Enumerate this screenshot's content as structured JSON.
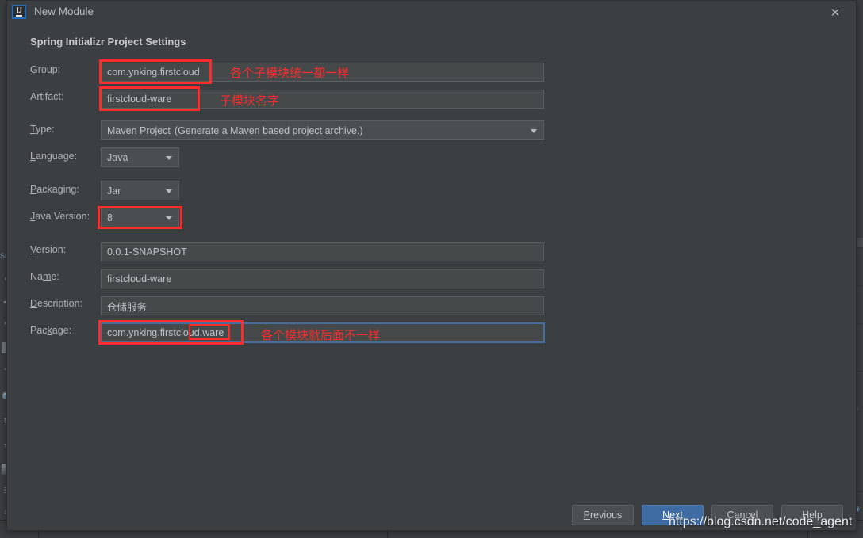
{
  "window": {
    "title": "New Module",
    "app_icon": "intellij-idea-logo",
    "close_icon": "close-icon"
  },
  "section": {
    "heading": "Spring Initializr Project Settings"
  },
  "form": {
    "group": {
      "label": "Group:",
      "mnemonic": "G",
      "value": "com.ynking.firstcloud"
    },
    "artifact": {
      "label": "Artifact:",
      "mnemonic": "A",
      "value": "firstcloud-ware"
    },
    "type": {
      "label": "Type:",
      "mnemonic": "T",
      "value": "Maven Project",
      "hint": "(Generate a Maven based project archive.)"
    },
    "language": {
      "label": "Language:",
      "mnemonic": "L",
      "value": "Java"
    },
    "packaging": {
      "label": "Packaging:",
      "mnemonic": "P",
      "value": "Jar"
    },
    "java_version": {
      "label": "Java Version:",
      "mnemonic": "J",
      "value": "8"
    },
    "version": {
      "label": "Version:",
      "mnemonic": "V",
      "value": "0.0.1-SNAPSHOT"
    },
    "name": {
      "label": "Name:",
      "mnemonic": "m",
      "value": "firstcloud-ware"
    },
    "description": {
      "label": "Description:",
      "mnemonic": "D",
      "value": "仓储服务"
    },
    "package": {
      "label": "Package:",
      "mnemonic": "k",
      "value_prefix": "com.ynking.firstcloud.",
      "value_suffix": "ware",
      "value": "com.ynking.firstcloud.ware"
    }
  },
  "annotations": [
    {
      "text": "各个子模块统一都一样",
      "target": "group"
    },
    {
      "text": "子模块名字",
      "target": "artifact"
    },
    {
      "text": "各个模块就后面不一样",
      "target": "package"
    }
  ],
  "buttons": {
    "previous": {
      "label": "Previous",
      "mnemonic": "P"
    },
    "next": {
      "label": "Next",
      "mnemonic": "N"
    },
    "cancel": {
      "label": "Cancel"
    },
    "help": {
      "label": "Help"
    }
  },
  "watermark": "https://blog.csdn.net/code_agent",
  "colors": {
    "dialog_bg": "#3c3f41",
    "field_bg": "#45494a",
    "accent_blue": "#3f6ca3",
    "annotation_red": "#fb2c2c",
    "focus_border": "#466da0"
  }
}
